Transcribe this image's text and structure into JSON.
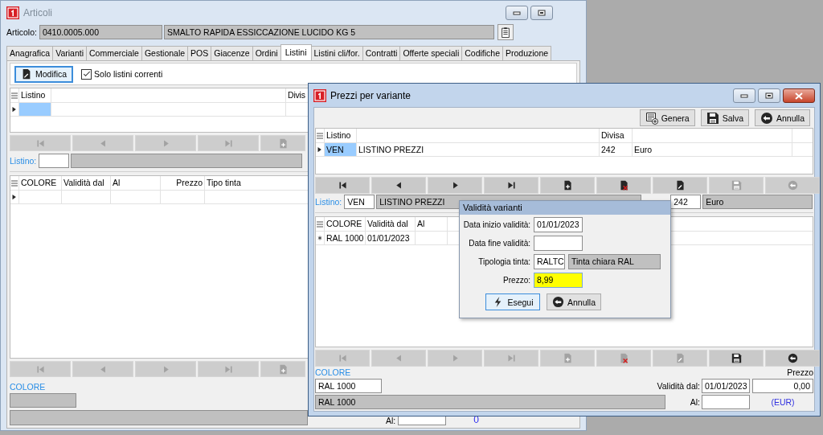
{
  "main_window": {
    "title": "Articoli",
    "active": false,
    "article": {
      "label": "Articolo:",
      "code": "0410.0005.000",
      "description": "SMALTO RAPIDA ESSICCAZIONE LUCIDO KG 5"
    },
    "tabs": [
      {
        "label": "Anagrafica",
        "selected": false
      },
      {
        "label": "Varianti",
        "selected": false
      },
      {
        "label": "Commerciale",
        "selected": false
      },
      {
        "label": "Gestionale",
        "selected": false
      },
      {
        "label": "POS",
        "selected": false
      },
      {
        "label": "Giacenze",
        "selected": false
      },
      {
        "label": "Ordini",
        "selected": false
      },
      {
        "label": "Listini",
        "selected": true
      },
      {
        "label": "Listini cli/for.",
        "selected": false
      },
      {
        "label": "Contratti",
        "selected": false
      },
      {
        "label": "Offerte speciali",
        "selected": false
      },
      {
        "label": "Codifiche",
        "selected": false
      },
      {
        "label": "Produzione",
        "selected": false
      }
    ],
    "edit_button": "Modifica",
    "current_only": {
      "label": "Solo listini correnti",
      "checked": true
    },
    "price_list_grid": {
      "columns": [
        "Listino",
        "Divis"
      ],
      "rows": [
        {
          "current": true,
          "selected": true
        }
      ]
    },
    "nav_top": [
      {
        "kind": "first",
        "disabled": true
      },
      {
        "kind": "prev",
        "disabled": true
      },
      {
        "kind": "next",
        "disabled": true
      },
      {
        "kind": "last",
        "disabled": true
      },
      {
        "kind": "new",
        "disabled": true
      }
    ],
    "price_list_label": "Listino:",
    "variant_grid": {
      "columns": [
        "COLORE",
        "Validità dal",
        "Al",
        "Prezzo",
        "Tipo tinta"
      ],
      "rows": [
        {
          "current": true,
          "selected": false
        }
      ]
    },
    "nav_bottom": [
      {
        "kind": "first",
        "disabled": true
      },
      {
        "kind": "prev",
        "disabled": true
      },
      {
        "kind": "next",
        "disabled": true
      },
      {
        "kind": "last",
        "disabled": true
      },
      {
        "kind": "new",
        "disabled": true
      }
    ],
    "color_label": "COLORE",
    "to_label": "Al:",
    "amount": "0"
  },
  "variant_window": {
    "title": "Prezzi per variante",
    "active": true,
    "toolbar": [
      {
        "kind": "generate",
        "label": "Genera"
      },
      {
        "kind": "save",
        "label": "Salva"
      },
      {
        "kind": "cancel",
        "label": "Annulla"
      }
    ],
    "price_list_grid": {
      "columns": [
        "Listino",
        "Divisa"
      ],
      "rows": [
        {
          "current": true,
          "selected": true,
          "code": "VEN",
          "name": "LISTINO PREZZI",
          "currency_code": "242",
          "currency": "Euro"
        }
      ]
    },
    "nav_top": [
      {
        "kind": "first",
        "disabled": false
      },
      {
        "kind": "prev",
        "disabled": false
      },
      {
        "kind": "next",
        "disabled": false
      },
      {
        "kind": "last",
        "disabled": false
      },
      {
        "kind": "new",
        "disabled": false
      },
      {
        "kind": "delete",
        "disabled": false
      },
      {
        "kind": "edit",
        "disabled": false
      },
      {
        "kind": "save",
        "disabled": true
      },
      {
        "kind": "undo",
        "disabled": true
      }
    ],
    "price_list": {
      "label": "Listino:",
      "code": "VEN",
      "name": "LISTINO PREZZI",
      "currency_code": "242",
      "currency": "Euro"
    },
    "variant_grid": {
      "columns": [
        "COLORE",
        "Validità dal",
        "Al"
      ],
      "rows": [
        {
          "new": true,
          "colore": "RAL 1000",
          "from": "01/01/2023"
        }
      ]
    },
    "nav_bottom": [
      {
        "kind": "first",
        "disabled": true
      },
      {
        "kind": "prev",
        "disabled": true
      },
      {
        "kind": "next",
        "disabled": true
      },
      {
        "kind": "last",
        "disabled": true
      },
      {
        "kind": "new",
        "disabled": true
      },
      {
        "kind": "delete",
        "disabled": true
      },
      {
        "kind": "edit",
        "disabled": true
      },
      {
        "kind": "save",
        "disabled": false
      },
      {
        "kind": "undo",
        "disabled": false
      }
    ],
    "footer": {
      "color_label": "COLORE",
      "price_label": "Prezzo",
      "color_code": "RAL 1000",
      "color_name": "RAL  1000",
      "from_label": "Validità dal:",
      "from": "01/01/2023",
      "price": "0,00",
      "to_label": "Al:",
      "currency": "(EUR)"
    }
  },
  "dialog": {
    "title": "Validità varianti",
    "fields": [
      {
        "label": "Data inizio validità:",
        "value": "01/01/2023",
        "highlighted": false
      },
      {
        "label": "Data fine validità:",
        "highlighted": false
      },
      {
        "label": "Tipologia tinta:",
        "value": "RALTC",
        "description": "Tinta chiara RAL",
        "highlighted": false
      },
      {
        "label": "Prezzo:",
        "value": "8,99",
        "highlighted": true
      }
    ],
    "buttons": [
      {
        "kind": "run",
        "label": "Esegui",
        "focused": true
      },
      {
        "kind": "cancel",
        "label": "Annulla",
        "focused": false
      }
    ]
  }
}
